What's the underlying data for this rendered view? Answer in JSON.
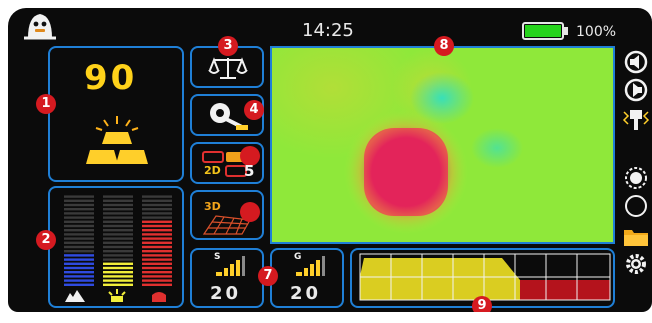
{
  "status_bar": {
    "time": "14:25",
    "battery_percent": "100%",
    "battery_level": 1.0,
    "icon": "ghost-logo-icon"
  },
  "badges": {
    "b1": "1",
    "b2": "2",
    "b3": "3",
    "b4": "4",
    "b5": "5",
    "b7": "7",
    "b8": "8",
    "b9": "9"
  },
  "depth_panel": {
    "value": "90",
    "icon": "gold-bars-icon"
  },
  "mode_buttons": {
    "balance": {
      "icon": "scale-icon"
    },
    "discrimination": {
      "icon": "gear-tool-icon"
    },
    "view_2d": {
      "label": "2D",
      "icon": "2d-view-icon"
    },
    "view_3d": {
      "label": "3D",
      "icon": "3d-view-icon"
    }
  },
  "level_bars": {
    "colors": [
      "#2f4be0",
      "#f1ee3a",
      "#e0302f"
    ],
    "levels": [
      0.35,
      0.28,
      0.72
    ],
    "icons": [
      "ground-icon",
      "light-icon",
      "metal-icon"
    ]
  },
  "sensitivity": {
    "label": "S",
    "value": "20",
    "icon": "signal-bars-icon"
  },
  "gain": {
    "label": "G",
    "value": "20",
    "icon": "signal-bars-icon"
  },
  "side_icons": [
    "speaker-left-icon",
    "speaker-right-icon",
    "frequency-icon",
    "brightness-icon",
    "night-mode-icon",
    "folder-icon",
    "settings-icon"
  ],
  "colors": {
    "accent": "#1f7fd6",
    "badge": "#d51a20",
    "gold": "#ffd21a"
  }
}
